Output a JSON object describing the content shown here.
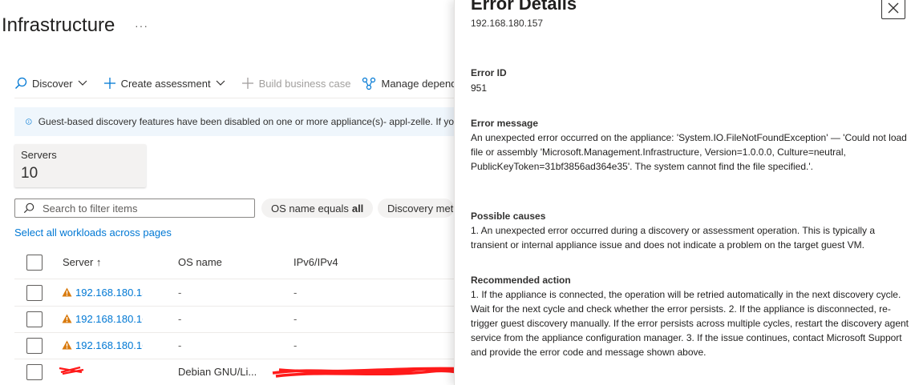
{
  "page": {
    "title": "Infrastructure",
    "more": "···"
  },
  "toolbar": {
    "discover": "Discover",
    "create_assessment": "Create assessment",
    "build_business_case": "Build business case",
    "manage_dependencies": "Manage depend"
  },
  "banner": {
    "text": "Guest-based discovery features have been disabled on one or more appliance(s)- appl-zelle. If yo"
  },
  "summary": {
    "servers_label": "Servers",
    "servers_count": "10"
  },
  "filters": {
    "search_placeholder": "Search to filter items",
    "os_pill_label": "OS name equals",
    "os_pill_value": "all",
    "discovery_pill": "Discovery met"
  },
  "select_all_link": "Select all workloads across pages",
  "table": {
    "headers": {
      "server": "Server ↑",
      "os": "OS name",
      "ip": "IPv6/IPv4"
    },
    "rows": [
      {
        "server": "192.168.180.157",
        "os": "-",
        "ip": "-",
        "warning": true
      },
      {
        "server": "192.168.180.16",
        "os": "-",
        "ip": "-",
        "warning": true
      },
      {
        "server": "192.168.180.16",
        "os": "-",
        "ip": "-",
        "warning": true
      },
      {
        "server": "",
        "os": "Debian GNU/Li...",
        "ip": "",
        "warning": false
      }
    ]
  },
  "panel": {
    "title": "Error Details",
    "subtitle": "192.168.180.157",
    "error_id_label": "Error ID",
    "error_id": "951",
    "error_message_label": "Error message",
    "error_message": "An unexpected error occurred on the appliance: 'System.IO.FileNotFoundException' — 'Could not load file or assembly 'Microsoft.Management.Infrastructure, Version=1.0.0.0, Culture=neutral, PublicKeyToken=31bf3856ad364e35'. The system cannot find the file specified.'.",
    "possible_causes_label": "Possible causes",
    "possible_causes": "1. An unexpected error occurred during a discovery or assessment operation. This is typically a transient or internal appliance issue and does not indicate a problem on the target guest VM.",
    "recommended_action_label": "Recommended action",
    "recommended_action": "1. If the appliance is connected, the operation will be retried automatically in the next discovery cycle. Wait for the next cycle and check whether the error persists. 2. If the appliance is disconnected, re-trigger guest discovery manually. If the error persists across multiple cycles, restart the discovery agent service from the appliance configuration manager. 3. If the issue continues, contact Microsoft Support and provide the error code and message shown above."
  },
  "colors": {
    "link": "#0078d4",
    "warning": "#d97a0d",
    "banner_bg": "#eff6fc",
    "redaction": "#ff1a1a"
  }
}
